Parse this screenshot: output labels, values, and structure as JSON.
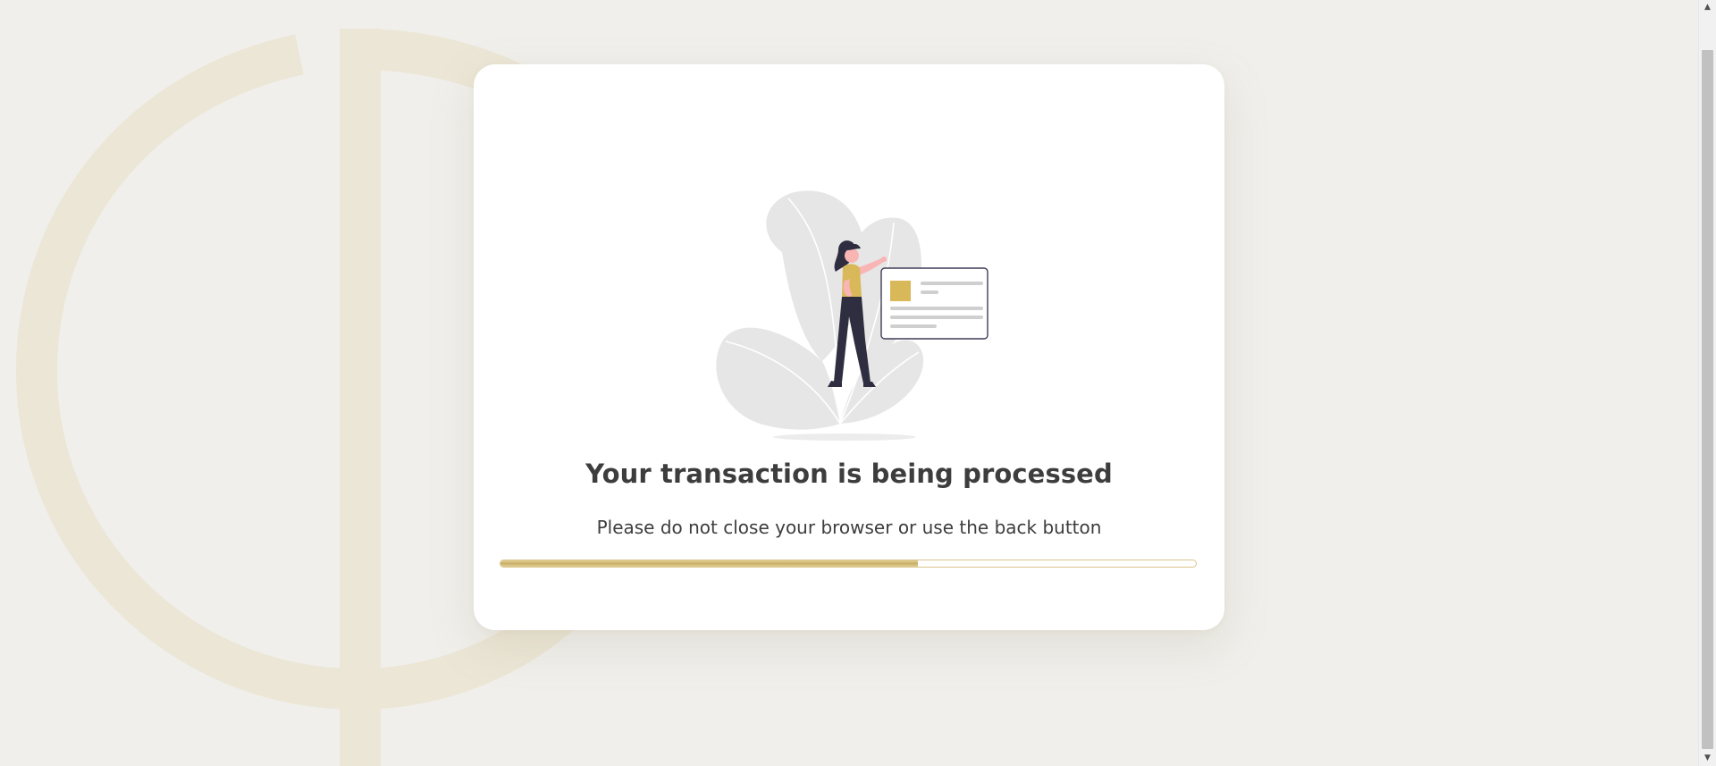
{
  "processing": {
    "title": "Your transaction is being processed",
    "subtitle": "Please do not close your browser or use the back button",
    "progress": 0.6
  },
  "colors": {
    "background": "#f0efeb",
    "card": "#ffffff",
    "accent_gold": "#d9b85a",
    "progress_border": "#d9c48a",
    "text": "#3d3d3d"
  },
  "icons": {
    "background_logo": "phi-logo-watermark",
    "illustration": "woman-with-credit-card-illustration",
    "scroll_up": "scroll-up-arrow-icon",
    "scroll_down": "scroll-down-arrow-icon"
  }
}
